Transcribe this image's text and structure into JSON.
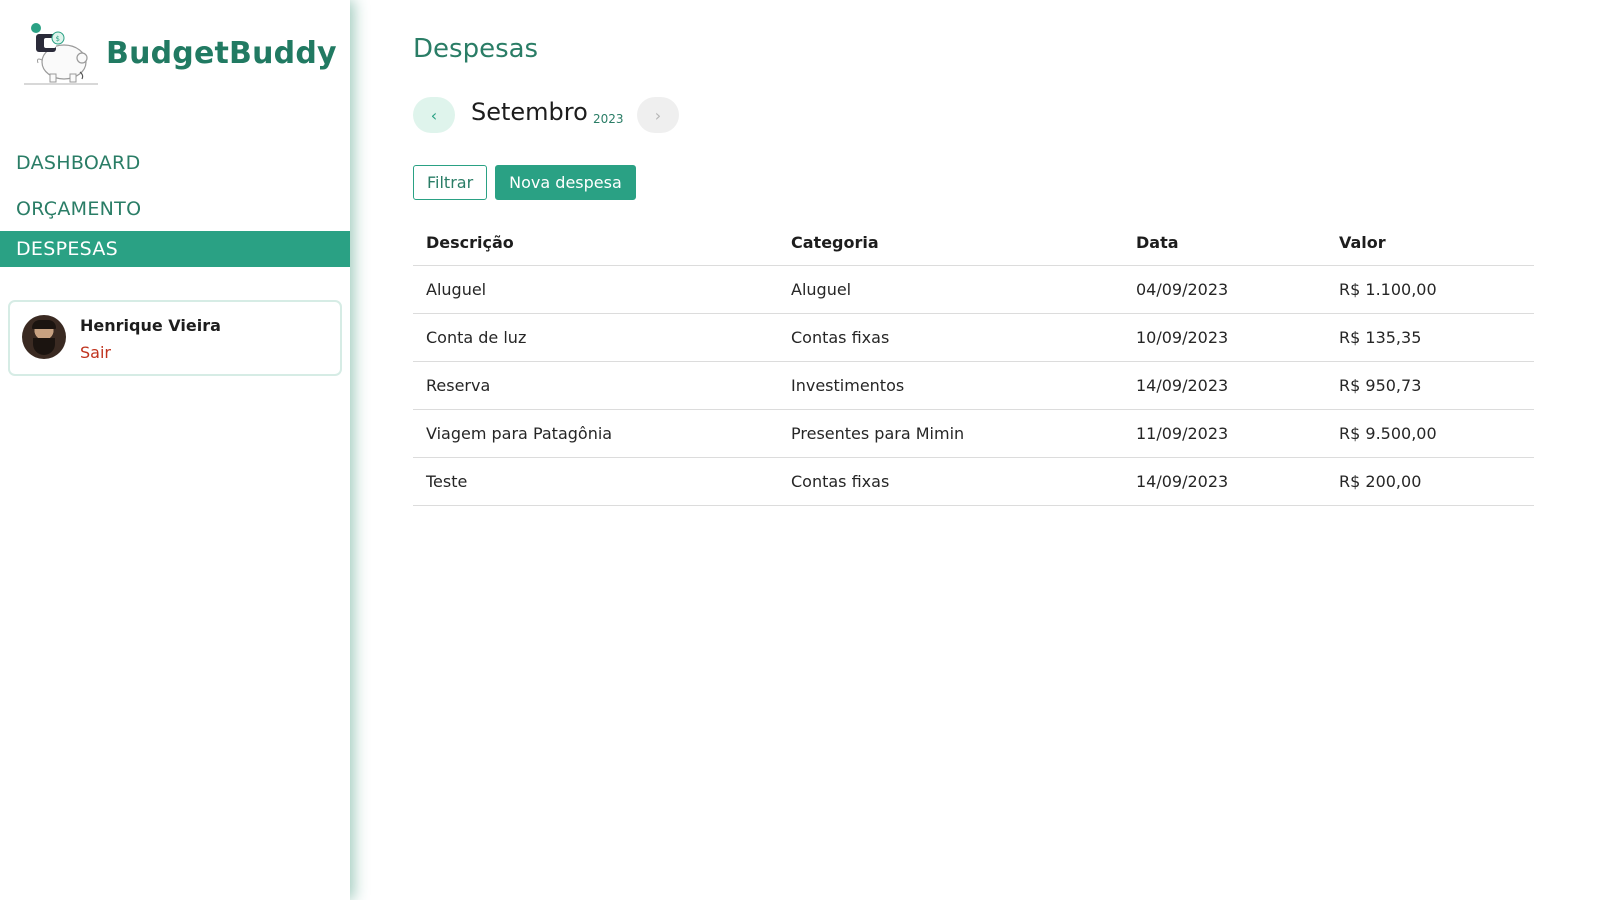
{
  "app": {
    "name": "BudgetBuddy"
  },
  "nav": {
    "items": [
      {
        "label": "DASHBOARD"
      },
      {
        "label": "ORÇAMENTO"
      },
      {
        "label": "DESPESAS"
      }
    ]
  },
  "user": {
    "name": "Henrique Vieira",
    "logout_label": "Sair"
  },
  "page": {
    "title": "Despesas"
  },
  "period": {
    "month": "Setembro",
    "year": "2023",
    "prev_icon": "chevron-left",
    "next_icon": "chevron-right"
  },
  "actions": {
    "filter_label": "Filtrar",
    "new_label": "Nova despesa"
  },
  "table": {
    "headers": [
      "Descrição",
      "Categoria",
      "Data",
      "Valor"
    ],
    "rows": [
      [
        "Aluguel",
        "Aluguel",
        "04/09/2023",
        "R$ 1.100,00"
      ],
      [
        "Conta de luz",
        "Contas fixas",
        "10/09/2023",
        "R$ 135,35"
      ],
      [
        "Reserva",
        "Investimentos",
        "14/09/2023",
        "R$ 950,73"
      ],
      [
        "Viagem para Patagônia",
        "Presentes para Mimin",
        "11/09/2023",
        "R$ 9.500,00"
      ],
      [
        "Teste",
        "Contas fixas",
        "14/09/2023",
        "R$ 200,00"
      ]
    ]
  },
  "colors": {
    "primary": "#2aa184",
    "brand_text": "#217a62",
    "danger": "#c0331e"
  }
}
